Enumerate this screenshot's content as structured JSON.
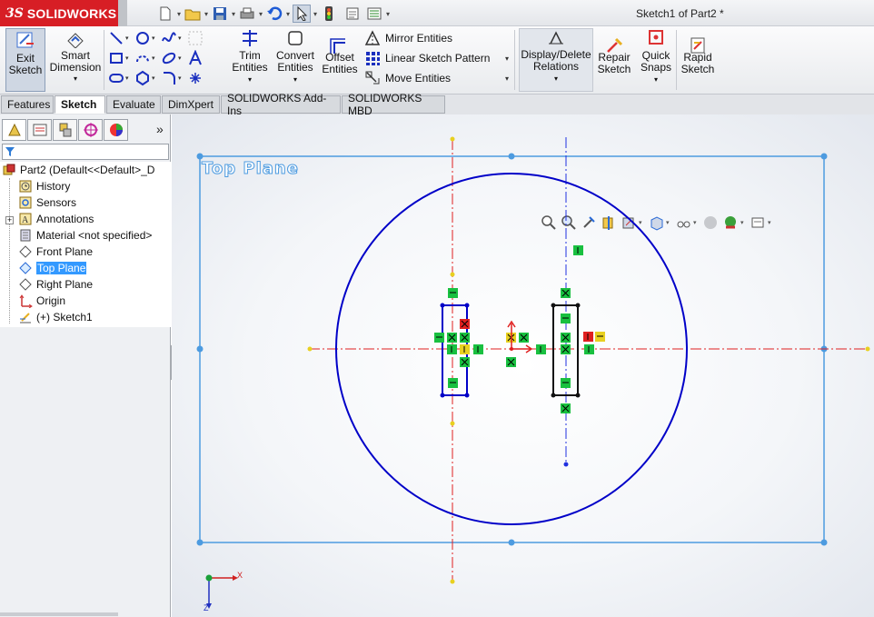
{
  "app": {
    "brand": "SOLIDWORKS",
    "brand_prefix": "3S",
    "document_title": "Sketch1 of Part2 *"
  },
  "quick_access": [
    {
      "icon": "new-document-icon"
    },
    {
      "icon": "open-folder-icon"
    },
    {
      "icon": "save-icon"
    },
    {
      "icon": "print-icon"
    },
    {
      "icon": "undo-icon"
    },
    {
      "icon": "select-arrow-icon"
    },
    {
      "icon": "rebuild-traffic-light-icon"
    },
    {
      "icon": "file-properties-icon"
    },
    {
      "icon": "options-icon"
    }
  ],
  "command_manager": {
    "exit_sketch": "Exit\nSketch",
    "smart_dimension": "Smart\nDimension",
    "trim_entities": "Trim\nEntities",
    "convert_entities": "Convert\nEntities",
    "offset_entities": "Offset\nEntities",
    "mirror_entities": "Mirror Entities",
    "linear_sketch_pattern": "Linear Sketch Pattern",
    "move_entities": "Move Entities",
    "display_delete_relations": "Display/Delete\nRelations",
    "repair_sketch": "Repair\nSketch",
    "quick_snaps": "Quick\nSnaps",
    "rapid_sketch": "Rapid\nSketch"
  },
  "tabs": [
    {
      "label": "Features",
      "active": false
    },
    {
      "label": "Sketch",
      "active": true
    },
    {
      "label": "Evaluate",
      "active": false
    },
    {
      "label": "DimXpert",
      "active": false
    },
    {
      "label": "SOLIDWORKS Add-Ins",
      "active": false
    },
    {
      "label": "SOLIDWORKS MBD",
      "active": false
    }
  ],
  "panel_tabs": [
    {
      "icon": "feature-manager-icon"
    },
    {
      "icon": "property-manager-icon"
    },
    {
      "icon": "configuration-manager-icon"
    },
    {
      "icon": "dimxpert-manager-icon"
    },
    {
      "icon": "display-manager-icon"
    }
  ],
  "panel_more": "»",
  "feature_tree": [
    {
      "label": "Part2  (Default<<Default>_D",
      "icon": "part-icon",
      "selected": false
    },
    {
      "label": "History",
      "icon": "history-icon",
      "selected": false
    },
    {
      "label": "Sensors",
      "icon": "sensors-icon",
      "selected": false
    },
    {
      "label": "Annotations",
      "icon": "annotations-icon",
      "selected": false
    },
    {
      "label": "Material <not specified>",
      "icon": "material-icon",
      "selected": false
    },
    {
      "label": "Front Plane",
      "icon": "plane-icon",
      "selected": false
    },
    {
      "label": "Top Plane",
      "icon": "plane-icon",
      "selected": true
    },
    {
      "label": "Right Plane",
      "icon": "plane-icon",
      "selected": false
    },
    {
      "label": "Origin",
      "icon": "origin-icon",
      "selected": false
    },
    {
      "label": "(+) Sketch1",
      "icon": "sketch-icon",
      "selected": false
    }
  ],
  "tree_expander": "+",
  "graphics": {
    "plane_label": "Top Plane",
    "triad_x": "X",
    "triad_z": "Z"
  },
  "colors": {
    "sketch_blue": "#0000c8",
    "centerline_red": "#e02020",
    "plane_border": "#4d9be0",
    "relation_green": "#19c040",
    "selection_blue": "#3399ff",
    "brand_red": "#d71e25"
  }
}
